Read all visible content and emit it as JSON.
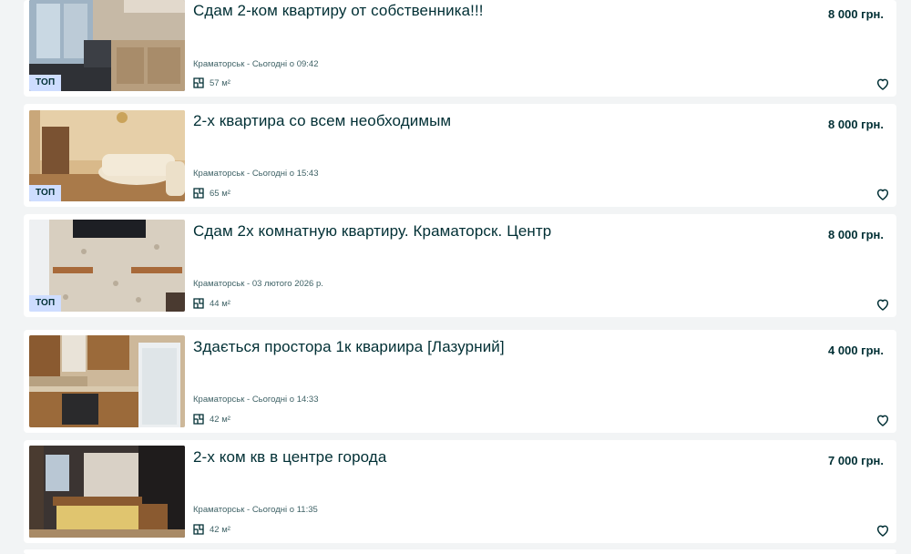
{
  "listings": [
    {
      "title": "Сдам 2-ком квартиру от собственника!!!",
      "price": "8 000 грн.",
      "location_date": "Краматорськ - Сьогодні о 09:42",
      "area": "57 м²",
      "badge": "ТОП"
    },
    {
      "title": "2-х квартира со всем необходимым",
      "price": "8 000 грн.",
      "location_date": "Краматорськ - Сьогодні о 15:43",
      "area": "65 м²",
      "badge": "ТОП"
    },
    {
      "title": "Сдам 2х комнатную квартиру. Краматорск. Центр",
      "price": "8 000 грн.",
      "location_date": "Краматорськ - 03 лютого 2026 р.",
      "area": "44 м²",
      "badge": "ТОП"
    },
    {
      "title": "Здається простора 1к квариира [Лазурний]",
      "price": "4 000 грн.",
      "location_date": "Краматорськ - Сьогодні о 14:33",
      "area": "42 м²",
      "badge": ""
    },
    {
      "title": "2-х ком кв в центре города",
      "price": "7 000 грн.",
      "location_date": "Краматорськ - Сьогодні о 11:35",
      "area": "42 м²",
      "badge": ""
    }
  ],
  "icons": {
    "area": "floor-plan-icon",
    "favorite": "heart-outline-icon"
  },
  "colors": {
    "page_bg": "#f2f4f5",
    "card_bg": "#ffffff",
    "text": "#002f34",
    "muted": "#406367",
    "top_badge_bg": "#ceddff"
  }
}
